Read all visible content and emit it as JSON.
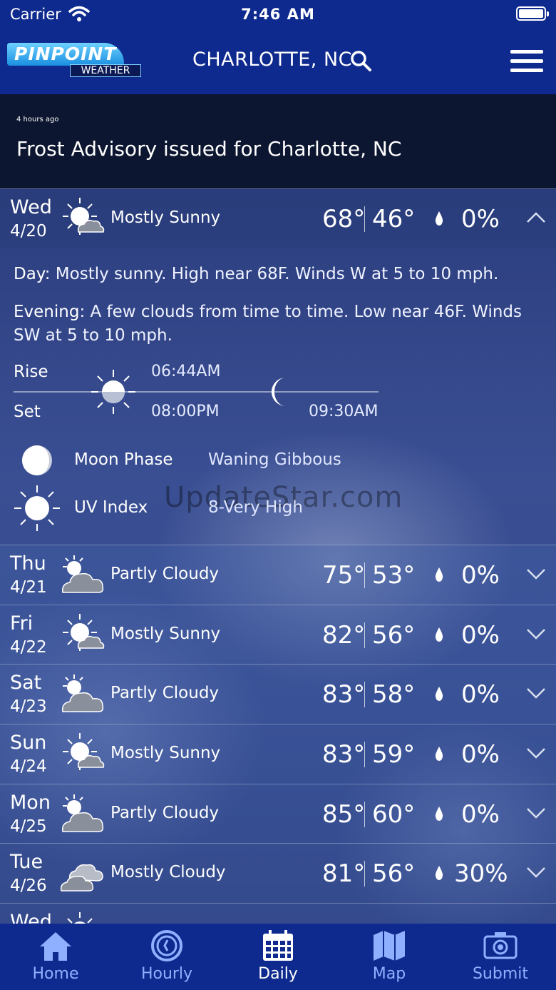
{
  "status_bar": {
    "carrier": "Carrier",
    "time": "7:46 AM"
  },
  "header": {
    "logo_top": "PINPOINT",
    "logo_bottom": "WEATHER",
    "city": "CHARLOTTE, NC",
    "search_icon": "search-icon",
    "menu_icon": "hamburger-menu-icon"
  },
  "alert": {
    "time": "4 hours ago",
    "text": "Frost Advisory issued for Charlotte, NC"
  },
  "watermark": "UpdateStar.com",
  "forecast": [
    {
      "day": "Wed",
      "date": "4/20",
      "icon": "mostly-sunny-icon",
      "condition": "Mostly Sunny",
      "high": "68°",
      "low": "46°",
      "precip": "0%",
      "expanded": true
    },
    {
      "day": "Thu",
      "date": "4/21",
      "icon": "partly-cloudy-icon",
      "condition": "Partly Cloudy",
      "high": "75°",
      "low": "53°",
      "precip": "0%"
    },
    {
      "day": "Fri",
      "date": "4/22",
      "icon": "mostly-sunny-icon",
      "condition": "Mostly Sunny",
      "high": "82°",
      "low": "56°",
      "precip": "0%"
    },
    {
      "day": "Sat",
      "date": "4/23",
      "icon": "partly-cloudy-icon",
      "condition": "Partly Cloudy",
      "high": "83°",
      "low": "58°",
      "precip": "0%"
    },
    {
      "day": "Sun",
      "date": "4/24",
      "icon": "mostly-sunny-icon",
      "condition": "Mostly Sunny",
      "high": "83°",
      "low": "59°",
      "precip": "0%"
    },
    {
      "day": "Mon",
      "date": "4/25",
      "icon": "partly-cloudy-icon",
      "condition": "Partly Cloudy",
      "high": "85°",
      "low": "60°",
      "precip": "0%"
    },
    {
      "day": "Tue",
      "date": "4/26",
      "icon": "mostly-cloudy-icon",
      "condition": "Mostly Cloudy",
      "high": "81°",
      "low": "56°",
      "precip": "30%"
    },
    {
      "day": "Wed",
      "date": "",
      "icon": "mostly-sunny-icon",
      "condition": "",
      "high": "",
      "low": "",
      "precip": ""
    }
  ],
  "details": {
    "day_label": "Day",
    "day_text": ": Mostly sunny. High near 68F. Winds W at 5 to 10 mph.",
    "evening_label": "Evening",
    "evening_text": ": A few clouds from time to time. Low near 46F. Winds SW at 5 to 10 mph.",
    "rise_label": "Rise",
    "set_label": "Set",
    "sunrise": "06:44AM",
    "sunset": "08:00PM",
    "moonset": "09:30AM",
    "moon_phase_label": "Moon Phase",
    "moon_phase_value": "Waning Gibbous",
    "uv_label": "UV Index",
    "uv_value": "8-Very High"
  },
  "tabs": [
    {
      "label": "Home",
      "icon": "home-icon"
    },
    {
      "label": "Hourly",
      "icon": "clock-icon"
    },
    {
      "label": "Daily",
      "icon": "calendar-icon",
      "active": true
    },
    {
      "label": "Map",
      "icon": "map-icon"
    },
    {
      "label": "Submit",
      "icon": "camera-icon"
    }
  ],
  "colors": {
    "header_bg": "#0e2a8e",
    "alert_bg": "#0d1630",
    "tab_inactive": "#8fb0ff",
    "tab_active": "#ffffff"
  }
}
